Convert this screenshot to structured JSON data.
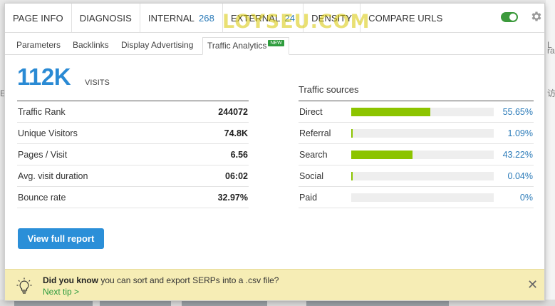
{
  "background": {
    "right_fragments": [
      "L",
      "ra",
      "E",
      "访"
    ]
  },
  "nav": {
    "items": [
      {
        "label": "PAGE INFO"
      },
      {
        "label": "DIAGNOSIS"
      },
      {
        "label": "INTERNAL",
        "count": "268"
      },
      {
        "label": "EXTERNAL",
        "count": "24"
      },
      {
        "label": "DENSITY"
      },
      {
        "label": "COMPARE URLS"
      }
    ],
    "watermark": "LOYSEU.COM",
    "toggle_on": true
  },
  "subtabs": {
    "items": [
      "Parameters",
      "Backlinks",
      "Display Advertising",
      "Traffic Analytics"
    ],
    "active": "Traffic Analytics",
    "new_badge": "NEW"
  },
  "visits": {
    "value": "112K",
    "label": "VISITS"
  },
  "stats": [
    {
      "label": "Traffic Rank",
      "value": "244072"
    },
    {
      "label": "Unique Visitors",
      "value": "74.8K"
    },
    {
      "label": "Pages / Visit",
      "value": "6.56"
    },
    {
      "label": "Avg. visit duration",
      "value": "06:02"
    },
    {
      "label": "Bounce rate",
      "value": "32.97%"
    }
  ],
  "traffic_sources": {
    "title": "Traffic sources",
    "bar_color": "#8cc400",
    "items": [
      {
        "name": "Direct",
        "pct": "55.65%",
        "share": 55.65
      },
      {
        "name": "Referral",
        "pct": "1.09%",
        "share": 1.09
      },
      {
        "name": "Search",
        "pct": "43.22%",
        "share": 43.22
      },
      {
        "name": "Social",
        "pct": "0.04%",
        "share": 0.04
      },
      {
        "name": "Paid",
        "pct": "0%",
        "share": 0
      }
    ]
  },
  "report_button": "View full report",
  "tip": {
    "bold": "Did you know",
    "text": " you can sort and export SERPs into a .csv file?",
    "link": "Next tip >"
  },
  "colors": {
    "accent": "#2b8fd8",
    "bar": "#8cc400",
    "tip_bg": "#f6edb5"
  }
}
